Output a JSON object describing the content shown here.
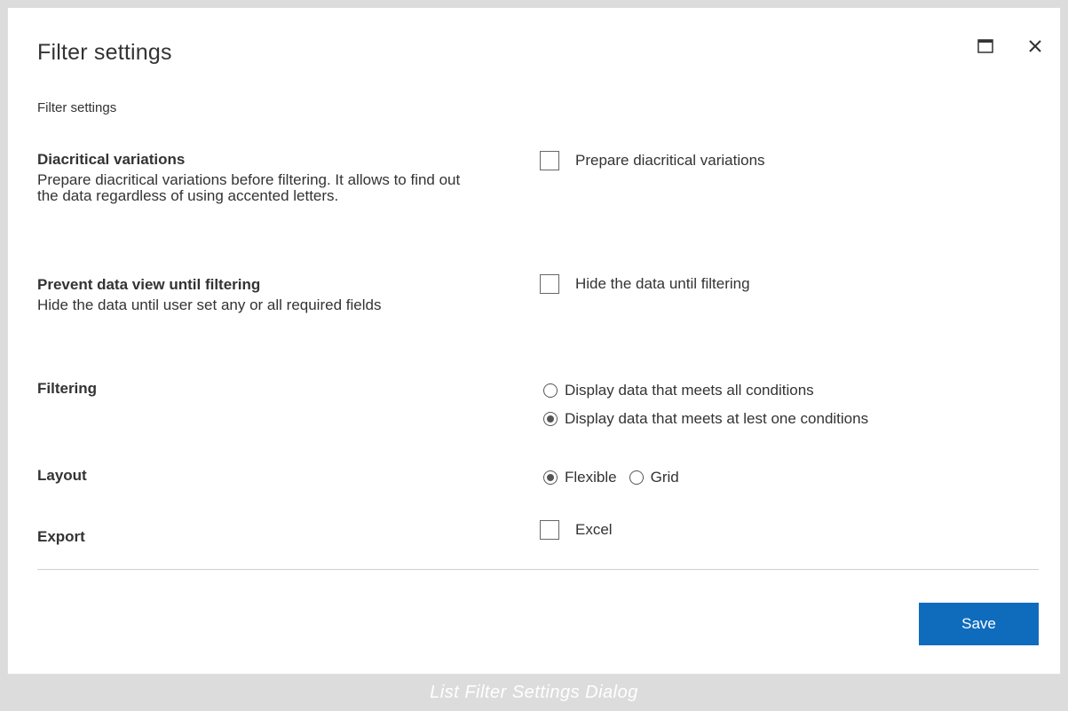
{
  "dialog": {
    "title": "Filter settings",
    "subtitle": "Filter settings",
    "maximize_icon": "maximize-icon",
    "close_icon": "close-icon"
  },
  "sections": {
    "diacritical": {
      "label": "Diacritical variations",
      "description": "Prepare diacritical variations before filtering. It allows to find out the data regardless of using accented letters.",
      "checkbox_label": "Prepare diacritical variations",
      "checked": false
    },
    "prevent_view": {
      "label": "Prevent data view until filtering",
      "description": "Hide the data until user set any or all required fields",
      "checkbox_label": "Hide the data until filtering",
      "checked": false
    },
    "filtering": {
      "label": "Filtering",
      "options": [
        "Display data that meets all conditions",
        "Display data that meets at lest one conditions"
      ],
      "selected_index": 1
    },
    "layout": {
      "label": "Layout",
      "options": [
        "Flexible",
        "Grid"
      ],
      "selected_index": 0
    },
    "export": {
      "label": "Export",
      "checkbox_label": "Excel",
      "checked": false
    }
  },
  "footer": {
    "save_label": "Save"
  },
  "caption": "List Filter Settings Dialog",
  "colors": {
    "accent": "#0f6cbd",
    "caption_bg": "#dcdcdc",
    "divider": "#cfcfcf"
  }
}
